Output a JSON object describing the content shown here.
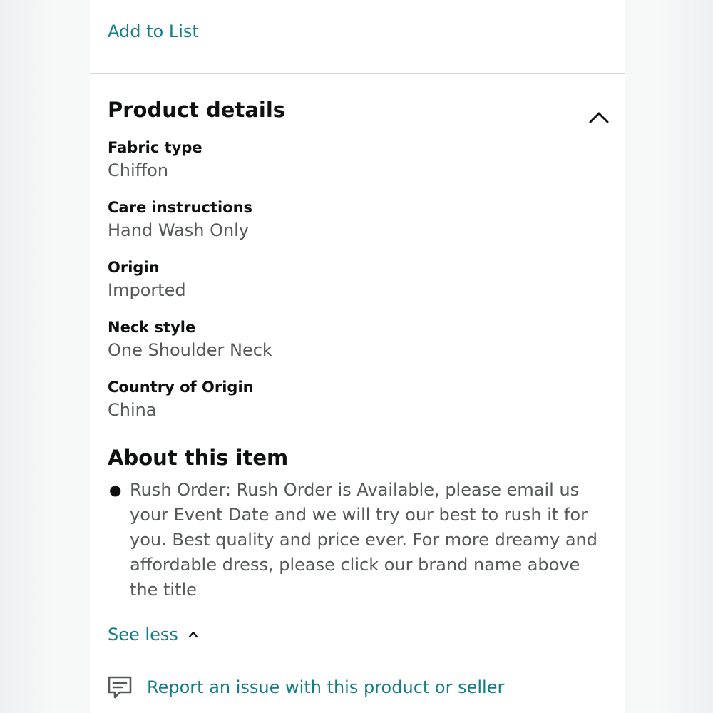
{
  "top_link": {
    "label": "Add to List"
  },
  "product_details": {
    "title": "Product details",
    "toggle_icon": "chevron-up-icon",
    "rows": [
      {
        "label": "Fabric type",
        "value": "Chiffon"
      },
      {
        "label": "Care instructions",
        "value": "Hand Wash Only"
      },
      {
        "label": "Origin",
        "value": "Imported"
      },
      {
        "label": "Neck style",
        "value": "One Shoulder Neck"
      },
      {
        "label": "Country of Origin",
        "value": "China"
      }
    ]
  },
  "about": {
    "title": "About this item",
    "items": [
      "Rush Order: Rush Order is Available, please email us your Event Date and we will try our best to rush it for you. Best quality and price ever. For more dreamy and affordable dress, please click our brand name above the title"
    ]
  },
  "see_less": {
    "label": "See less",
    "icon": "chevron-up-icon"
  },
  "report": {
    "label": "Report an issue with this product or seller",
    "icon": "message-flag-icon"
  },
  "colors": {
    "link": "#137c8a",
    "heading": "#0f1111",
    "value_text": "#565959",
    "divider": "#d5d9d9"
  }
}
